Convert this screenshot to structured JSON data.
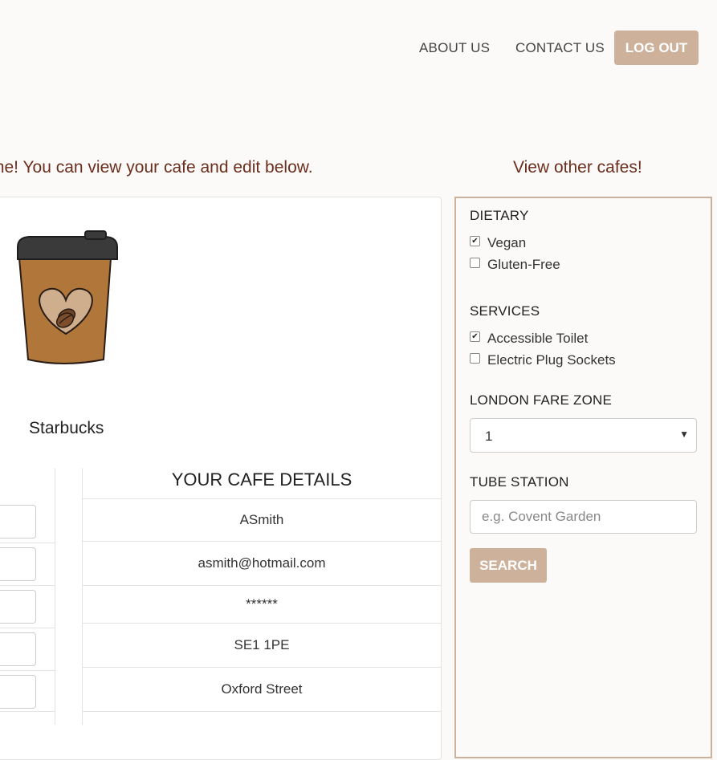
{
  "nav": {
    "about_label": "ABOUT US",
    "contact_label": "CONTACT US",
    "logout_label": "LOG OUT"
  },
  "main": {
    "welcome_text": "me! You can view your cafe and edit below.",
    "cafe_name": "Starbucks",
    "details_title": "YOUR CAFE DETAILS",
    "details": [
      "ASmith",
      "asmith@hotmail.com",
      "******",
      "SE1 1PE",
      "Oxford Street"
    ]
  },
  "sidebar": {
    "title": "View other cafes!",
    "dietary": {
      "heading": "DIETARY",
      "options": [
        {
          "label": "Vegan",
          "checked": true
        },
        {
          "label": "Gluten-Free",
          "checked": false
        }
      ]
    },
    "services": {
      "heading": "SERVICES",
      "options": [
        {
          "label": "Accessible Toilet",
          "checked": true
        },
        {
          "label": "Electric Plug Sockets",
          "checked": false
        }
      ]
    },
    "zone": {
      "heading": "LONDON FARE ZONE",
      "selected": "1"
    },
    "tube": {
      "heading": "TUBE STATION",
      "placeholder": "e.g. Covent Garden"
    },
    "search_label": "SEARCH"
  },
  "colors": {
    "accent": "#cdb19b",
    "heading_brown": "#6b2e1c",
    "cup_body": "#b0763a",
    "cup_lid": "#3a3a3a"
  },
  "icons": {
    "cup": "coffee-cup-icon",
    "checkmark": "checkmark-icon",
    "dropdown": "chevron-down-icon"
  }
}
